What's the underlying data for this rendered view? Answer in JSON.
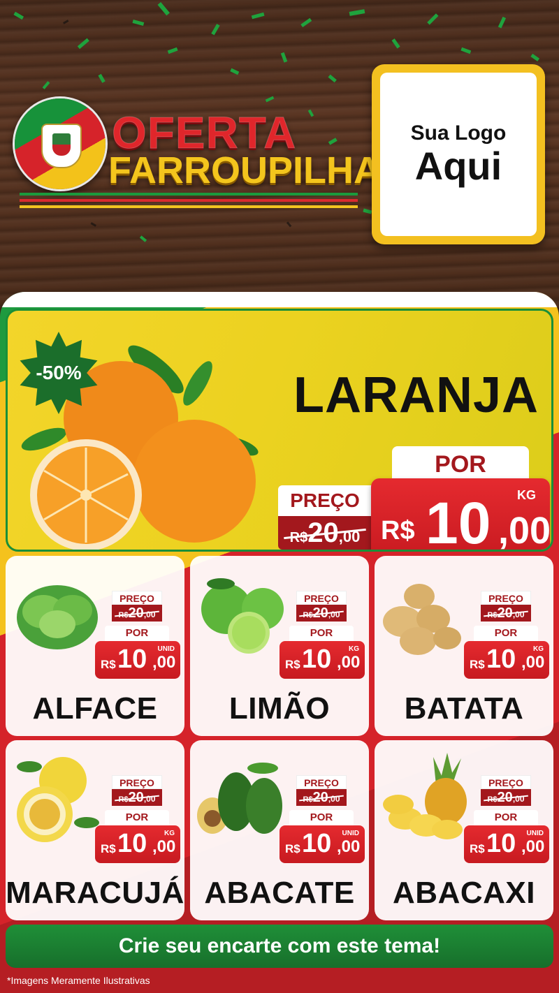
{
  "header": {
    "title_line1": "OFERTA",
    "title_line2": "FARROUPILHA",
    "logo_line1": "Sua Logo",
    "logo_line2": "Aqui"
  },
  "featured": {
    "discount": "-50%",
    "name": "LARANJA",
    "old_label": "PREÇO",
    "old_currency": "R$",
    "old_integer": "20",
    "old_decimal": ",00",
    "por_label": "POR",
    "unit": "KG",
    "currency": "R$",
    "price_integer": "10",
    "price_decimal": ",00"
  },
  "products": [
    {
      "name": "ALFACE",
      "old_label": "PREÇO",
      "old_currency": "R$",
      "old_integer": "20",
      "old_decimal": ",00",
      "por_label": "POR",
      "unit": "UNID",
      "currency": "R$",
      "price_integer": "10",
      "price_decimal": ",00",
      "icon": "lettuce-icon"
    },
    {
      "name": "LIMÃO",
      "old_label": "PREÇO",
      "old_currency": "R$",
      "old_integer": "20",
      "old_decimal": ",00",
      "por_label": "POR",
      "unit": "KG",
      "currency": "R$",
      "price_integer": "10",
      "price_decimal": ",00",
      "icon": "lime-icon"
    },
    {
      "name": "BATATA",
      "old_label": "PREÇO",
      "old_currency": "R$",
      "old_integer": "20",
      "old_decimal": ",00",
      "por_label": "POR",
      "unit": "KG",
      "currency": "R$",
      "price_integer": "10",
      "price_decimal": ",00",
      "icon": "potato-icon"
    },
    {
      "name": "MARACUJÁ",
      "old_label": "PREÇO",
      "old_currency": "R$",
      "old_integer": "20",
      "old_decimal": ",00",
      "por_label": "POR",
      "unit": "KG",
      "currency": "R$",
      "price_integer": "10",
      "price_decimal": ",00",
      "icon": "passion-fruit-icon"
    },
    {
      "name": "ABACATE",
      "old_label": "PREÇO",
      "old_currency": "R$",
      "old_integer": "20",
      "old_decimal": ",00",
      "por_label": "POR",
      "unit": "UNID",
      "currency": "R$",
      "price_integer": "10",
      "price_decimal": ",00",
      "icon": "avocado-icon"
    },
    {
      "name": "ABACAXI",
      "old_label": "PREÇO",
      "old_currency": "R$",
      "old_integer": "20",
      "old_decimal": ",00",
      "por_label": "POR",
      "unit": "UNID",
      "currency": "R$",
      "price_integer": "10",
      "price_decimal": ",00",
      "icon": "pineapple-icon"
    }
  ],
  "cta": "Crie seu encarte com este tema!",
  "disclaimer": "*Imagens Meramente Ilustrativas",
  "colors": {
    "green": "#1b9a3d",
    "red": "#d92a2f",
    "yellow": "#f3c420",
    "price_red": "#c71a20"
  }
}
